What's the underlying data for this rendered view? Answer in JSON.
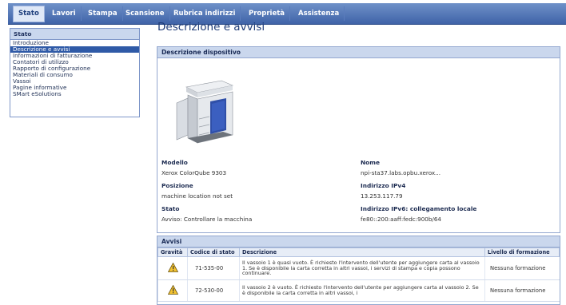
{
  "nav": {
    "tabs": [
      "Stato",
      "Lavori",
      "Stampa",
      "Scansione",
      "Rubrica indirizzi",
      "Proprietà",
      "Assistenza"
    ]
  },
  "sidebar": {
    "title": "Stato",
    "items": [
      {
        "label": "Introduzione"
      },
      {
        "label": "Descrizione e avvisi"
      },
      {
        "label": "Informazioni di fatturazione"
      },
      {
        "label": "Contatori di utilizzo"
      },
      {
        "label": "Rapporto di configurazione"
      },
      {
        "label": "Materiali di consumo"
      },
      {
        "label": "Vassoi"
      },
      {
        "label": "Pagine informative"
      },
      {
        "label": "SMart eSolutions"
      }
    ]
  },
  "main": {
    "title": "Descrizione e avvisi",
    "device_panel_title": "Descrizione dispositivo",
    "fields": {
      "modello_label": "Modello",
      "modello_value": "Xerox ColorQube 9303",
      "posizione_label": "Posizione",
      "posizione_value": "machine location not set",
      "stato_label": "Stato",
      "stato_value": "Avviso: Controllare la macchina",
      "nome_label": "Nome",
      "nome_value": "npi-sta37.labs.opbu.xerox...",
      "ipv4_label": "Indirizzo IPv4",
      "ipv4_value": "13.253.117.79",
      "ipv6_label": "Indirizzo IPv6: collegamento locale",
      "ipv6_value": "fe80::200:aaff:fedc:900b/64"
    },
    "avvisi": {
      "title": "Avvisi",
      "headers": [
        "Gravità",
        "Codice di stato",
        "Descrizione",
        "Livello di formazione"
      ],
      "rows": [
        {
          "code": "71-535-00",
          "description": "Il vassoio 1 è quasi vuoto. È richiesto l'intervento dell'utente per aggiungere carta al vassoio 1. Se è disponibile la carta corretta in altri vassoi, i servizi di stampa e copia possono continuare.",
          "level": "Nessuna formazione"
        },
        {
          "code": "72-530-00",
          "description": "Il vassoio 2 è vuoto. È richiesto l'intervento dell'utente per aggiungere carta al vassoio 2. Se è disponibile la carta corretta in altri vassoi, i",
          "level": "Nessuna formazione"
        }
      ]
    }
  }
}
